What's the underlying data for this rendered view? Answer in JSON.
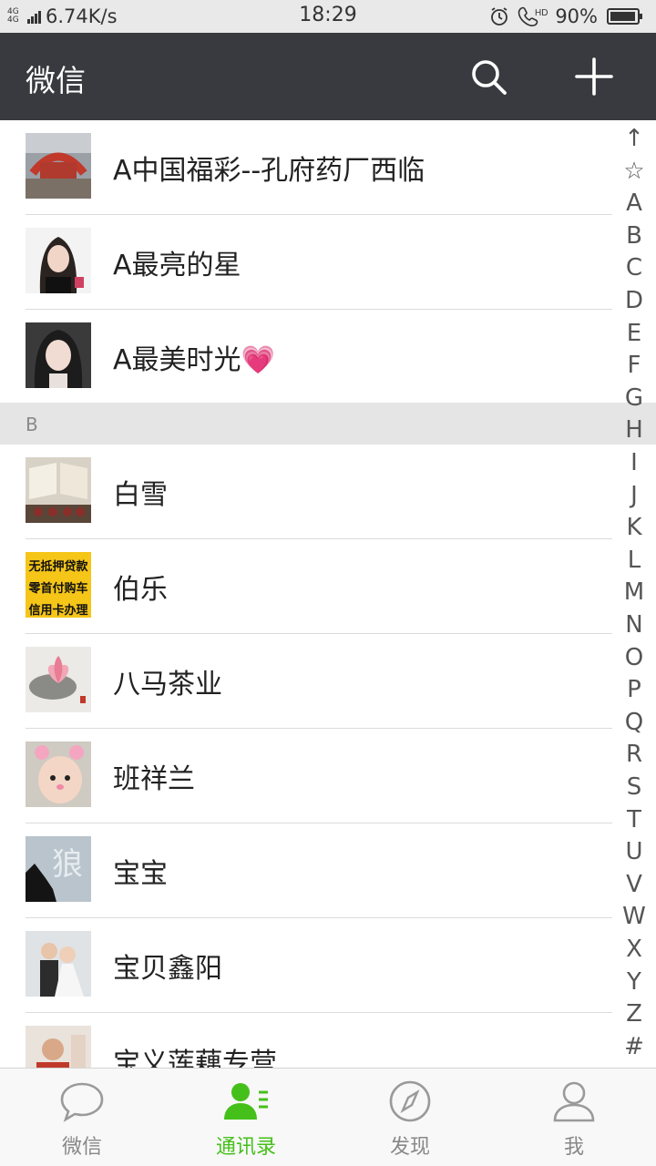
{
  "status_bar": {
    "network": "4G 4G",
    "speed": "6.74K/s",
    "time": "18:29",
    "hd_label": "HD",
    "battery": "90%"
  },
  "header": {
    "title": "微信",
    "icons": [
      "search-icon",
      "plus-icon"
    ]
  },
  "contacts_top": [
    {
      "name": "A中国福彩--孔府药厂西临",
      "avatar": "arch-photo"
    },
    {
      "name": "A最亮的星",
      "avatar": "woman-photo"
    },
    {
      "name": "A最美时光💗",
      "avatar": "woman-photo-2"
    }
  ],
  "section_b": {
    "letter": "B",
    "contacts": [
      {
        "name": "白雪",
        "avatar": "book-photo"
      },
      {
        "name": "伯乐",
        "avatar": "ad-banner",
        "avatar_text": [
          "无抵押贷款",
          "零首付购车",
          "信用卡办理"
        ]
      },
      {
        "name": "八马茶业",
        "avatar": "lotus-painting"
      },
      {
        "name": "班祥兰",
        "avatar": "baby-photo"
      },
      {
        "name": "宝宝",
        "avatar": "wolf-art",
        "avatar_text": [
          "狼"
        ]
      },
      {
        "name": "宝贝鑫阳",
        "avatar": "couple-photo"
      },
      {
        "name": "宝义莲藕专营",
        "avatar": "man-photo"
      }
    ]
  },
  "index_bar": [
    "↑",
    "☆",
    "A",
    "B",
    "C",
    "D",
    "E",
    "F",
    "G",
    "H",
    "I",
    "J",
    "K",
    "L",
    "M",
    "N",
    "O",
    "P",
    "Q",
    "R",
    "S",
    "T",
    "U",
    "V",
    "W",
    "X",
    "Y",
    "Z",
    "#"
  ],
  "tabs": [
    {
      "label": "微信",
      "icon": "chat-bubble-icon",
      "active": false
    },
    {
      "label": "通讯录",
      "icon": "contacts-icon",
      "active": true
    },
    {
      "label": "发现",
      "icon": "compass-icon",
      "active": false
    },
    {
      "label": "我",
      "icon": "person-icon",
      "active": false
    }
  ],
  "colors": {
    "header_bg": "#393a3f",
    "accent": "#45c01a",
    "section_bg": "#e5e5e5"
  }
}
